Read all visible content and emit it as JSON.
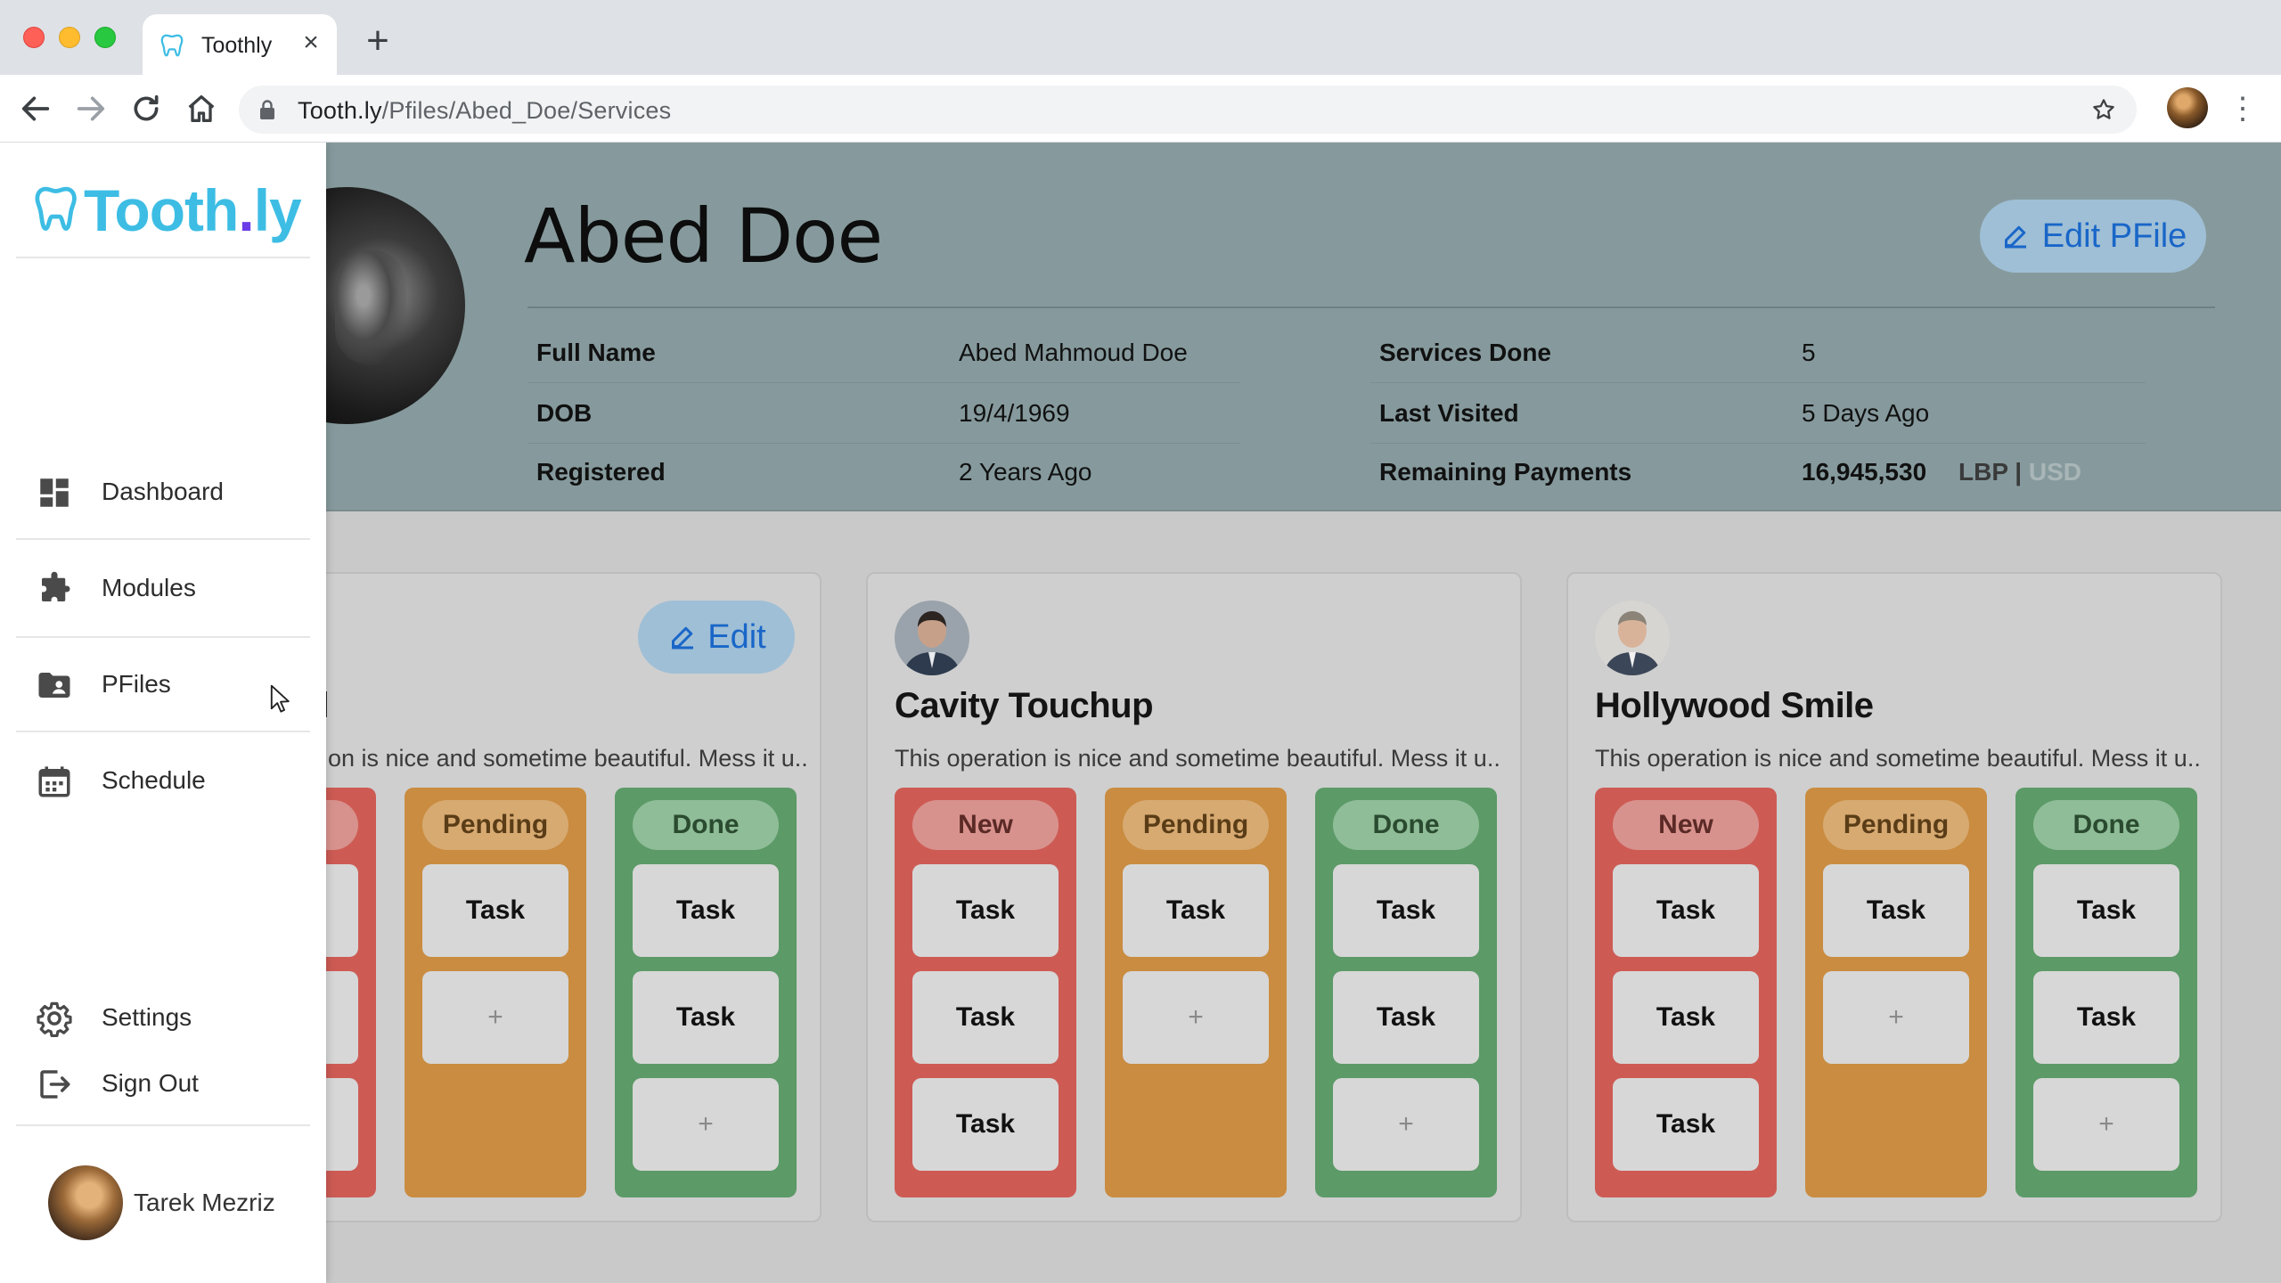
{
  "browser": {
    "tab_title": "Toothly",
    "tab_close": "×",
    "new_tab": "+",
    "url_host": "Tooth.ly",
    "url_path": "/Pfiles/Abed_Doe/Services",
    "menu": "⋮"
  },
  "sidebar": {
    "logo_main": "Tooth",
    "logo_dot": ".",
    "logo_tail": "ly",
    "items": [
      {
        "label": "Dashboard",
        "icon": "dashboard-icon"
      },
      {
        "label": "Modules",
        "icon": "puzzle-icon"
      },
      {
        "label": "PFiles",
        "icon": "folder-user-icon"
      },
      {
        "label": "Schedule",
        "icon": "calendar-icon"
      }
    ],
    "bottom_items": [
      {
        "label": "Settings",
        "icon": "gear-icon"
      },
      {
        "label": "Sign Out",
        "icon": "sign-out-icon"
      }
    ],
    "user_name": "Tarek Mezriz"
  },
  "patient": {
    "name": "Abed Doe",
    "edit_label": "Edit PFile",
    "details_left": [
      {
        "label": "Full Name",
        "value": "Abed Mahmoud Doe"
      },
      {
        "label": "DOB",
        "value": "19/4/1969"
      },
      {
        "label": "Registered",
        "value": "2 Years Ago"
      }
    ],
    "details_right": [
      {
        "label": "Services Done",
        "value": "5"
      },
      {
        "label": "Last Visited",
        "value": "5 Days Ago"
      },
      {
        "label": "Remaining Payments",
        "value": "16,945,530"
      }
    ],
    "currency_lbp": "LBP",
    "currency_sep": "|",
    "currency_usd": "USD"
  },
  "cards": [
    {
      "title": "ll",
      "description": "on is nice and sometime beautiful. Mess it u...",
      "edit_label": "Edit",
      "columns": [
        {
          "label": "",
          "tasks": [
            "",
            "",
            ""
          ]
        },
        {
          "label": "Pending",
          "tasks": [
            "Task",
            "+"
          ]
        },
        {
          "label": "Done",
          "tasks": [
            "Task",
            "Task",
            "+"
          ]
        }
      ]
    },
    {
      "title": "Cavity Touchup",
      "description": "This operation is nice and sometime beautiful. Mess it u...",
      "columns": [
        {
          "label": "New",
          "tasks": [
            "Task",
            "Task",
            "Task"
          ]
        },
        {
          "label": "Pending",
          "tasks": [
            "Task",
            "+"
          ]
        },
        {
          "label": "Done",
          "tasks": [
            "Task",
            "Task",
            "+"
          ]
        }
      ]
    },
    {
      "title": "Hollywood Smile",
      "description": "This operation is nice and sometime beautiful. Mess it u...",
      "columns": [
        {
          "label": "New",
          "tasks": [
            "Task",
            "Task",
            "Task"
          ]
        },
        {
          "label": "Pending",
          "tasks": [
            "Task",
            "+"
          ]
        },
        {
          "label": "Done",
          "tasks": [
            "Task",
            "Task",
            "+"
          ]
        }
      ]
    }
  ],
  "colors": {
    "brand": "#3dbde4",
    "brand_dot": "#6a3de8",
    "header_band": "#869a9d",
    "accent_button": "#1966c8",
    "col_new": "#cd5b54",
    "col_pending": "#c98c40",
    "col_done": "#5c9a67"
  }
}
